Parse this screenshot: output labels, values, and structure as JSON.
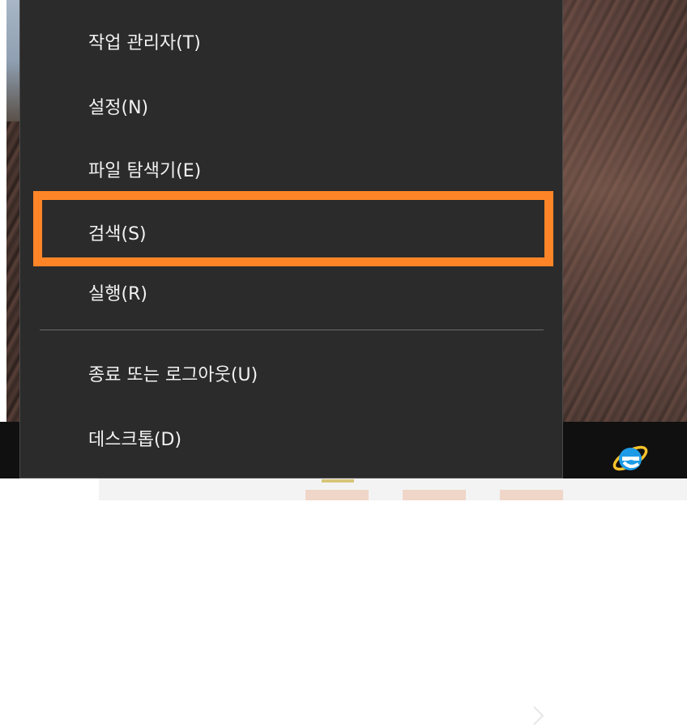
{
  "context_menu": {
    "items": [
      {
        "label": "작업 관리자(T)"
      },
      {
        "label": "설정(N)"
      },
      {
        "label": "파일 탐색기(E)"
      },
      {
        "label": "검색(S)"
      },
      {
        "label": "실행(R)"
      },
      {
        "label": "종료 또는 로그아웃(U)",
        "submenu_icon": "chevron-right-icon"
      },
      {
        "label": "데스크톱(D)"
      }
    ],
    "highlighted_item_index": 3
  },
  "taskbar": {
    "pinned_icon": "internet-explorer-icon"
  },
  "colors": {
    "menu_background": "#2b2b2b",
    "highlight_border": "#fd8527",
    "menu_text": "#f2f2f2",
    "ie_blue": "#1e9be6",
    "ie_ring": "#f5c22b"
  }
}
